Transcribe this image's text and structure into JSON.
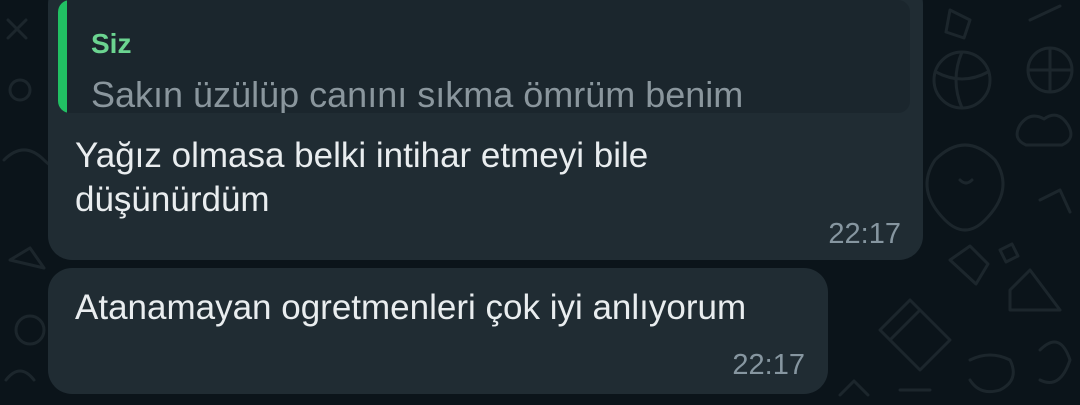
{
  "chat": {
    "messages": [
      {
        "reply": {
          "author": "Siz",
          "text": "Sakın üzülüp canını sıkma ömrüm benim"
        },
        "text": "Yağız olmasa belki intihar etmeyi bile düşünürdüm",
        "time": "22:17"
      },
      {
        "text": "Atanamayan ogretmenleri çok iyi anlıyorum",
        "time": "22:17"
      }
    ]
  },
  "colors": {
    "background": "#0b141a",
    "bubble": "#202c33",
    "quote_bar": "#21c063",
    "quote_author": "#6bd490",
    "text": "#e9edef",
    "meta": "#8696a0"
  }
}
